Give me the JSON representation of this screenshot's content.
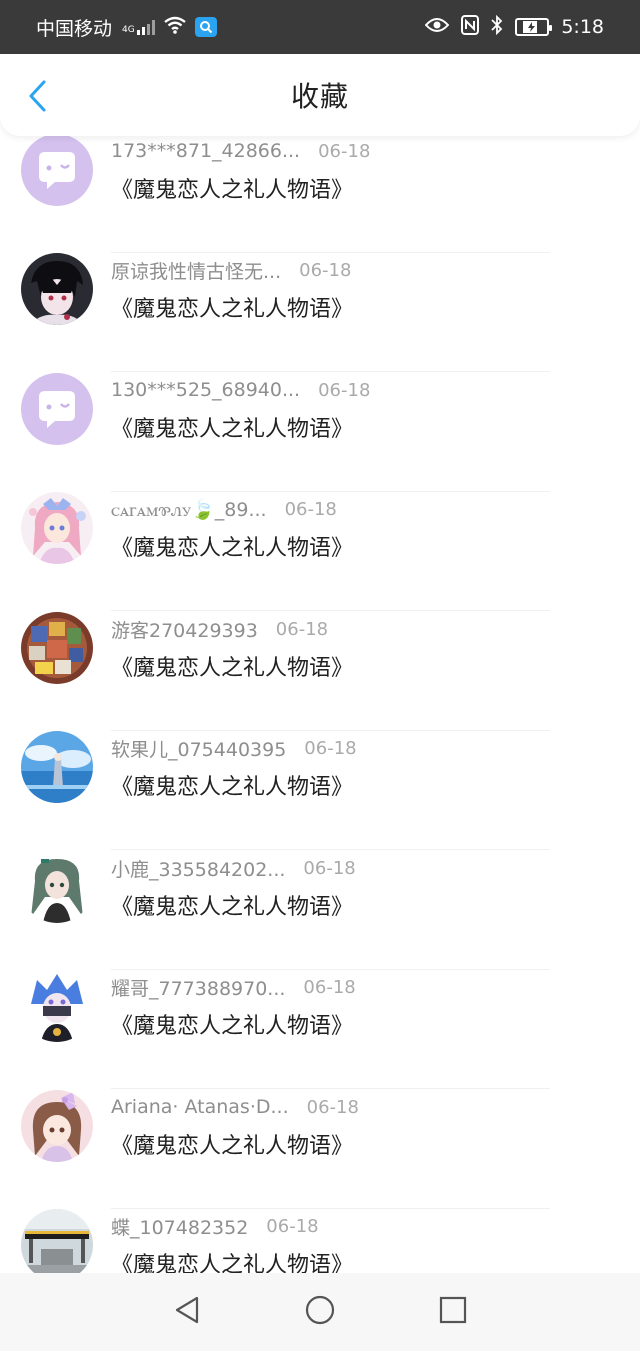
{
  "status_bar": {
    "carrier": "中国移动",
    "network_gen": "4G",
    "time": "5:18"
  },
  "header": {
    "title": "收藏",
    "back_icon": "chevron-left-icon",
    "accent_color": "#2aa3f0"
  },
  "items": [
    {
      "username": "173***871_42866...",
      "date": "06-18",
      "title": "《魔鬼恋人之礼人物语》",
      "avatar": "chat-bubble-default"
    },
    {
      "username": "原谅我性情古怪无...",
      "date": "06-18",
      "title": "《魔鬼恋人之礼人物语》",
      "avatar": "anime-dark-hair"
    },
    {
      "username": "130***525_68940...",
      "date": "06-18",
      "title": "《魔鬼恋人之礼人物语》",
      "avatar": "chat-bubble-default"
    },
    {
      "username": "ꮯꭺꮁꭺꮇꮘꮑꭹ🍃_89...",
      "date": "06-18",
      "title": "《魔鬼恋人之礼人物语》",
      "avatar": "anime-pink-girl"
    },
    {
      "username": "游客270429393",
      "date": "06-18",
      "title": "《魔鬼恋人之礼人物语》",
      "avatar": "cartoon-collage"
    },
    {
      "username": "软果儿_075440395",
      "date": "06-18",
      "title": "《魔鬼恋人之礼人物语》",
      "avatar": "sky-sea-scene"
    },
    {
      "username": "小鹿_335584202...",
      "date": "06-18",
      "title": "《魔鬼恋人之礼人物语》",
      "avatar": "anime-green-hair"
    },
    {
      "username": "耀哥_777388970...",
      "date": "06-18",
      "title": "《魔鬼恋人之礼人物语》",
      "avatar": "anime-blue-hair"
    },
    {
      "username": "Ariana· Atanas·D...",
      "date": "06-18",
      "title": "《魔鬼恋人之礼人物语》",
      "avatar": "anime-bow-girl"
    },
    {
      "username": "蝶_107482352",
      "date": "06-18",
      "title": "《魔鬼恋人之礼人物语》",
      "avatar": "building-photo"
    }
  ]
}
